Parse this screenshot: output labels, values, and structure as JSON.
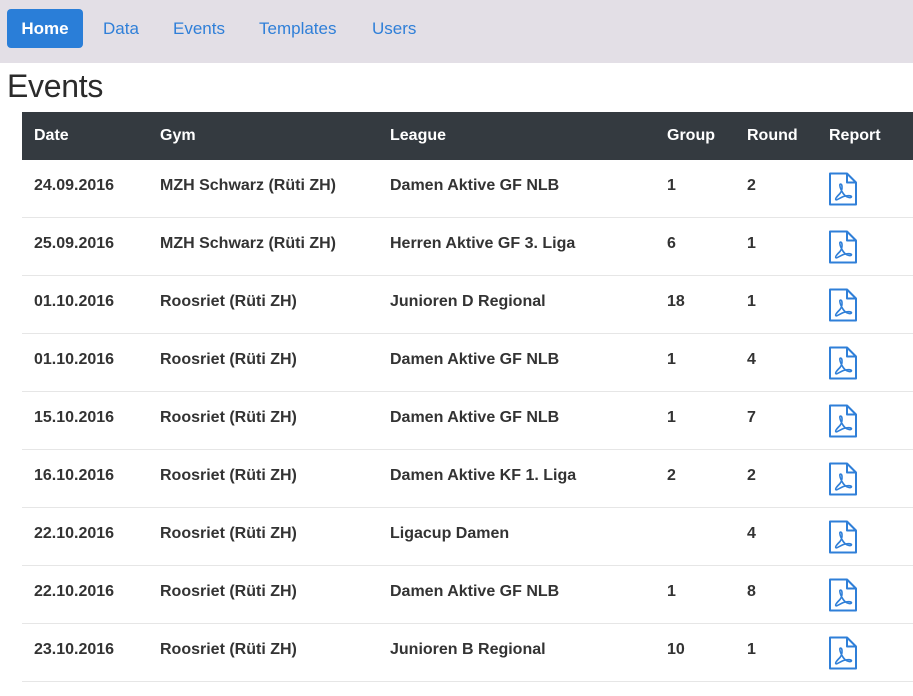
{
  "nav": {
    "items": [
      {
        "label": "Home",
        "active": true
      },
      {
        "label": "Data",
        "active": false
      },
      {
        "label": "Events",
        "active": false
      },
      {
        "label": "Templates",
        "active": false
      },
      {
        "label": "Users",
        "active": false
      }
    ]
  },
  "page": {
    "title": "Events"
  },
  "table": {
    "headers": [
      "Date",
      "Gym",
      "League",
      "Group",
      "Round",
      "Report"
    ],
    "report_icon": "pdf-file-icon",
    "rows": [
      {
        "date": "24.09.2016",
        "gym": "MZH Schwarz (Rüti ZH)",
        "league": "Damen Aktive GF NLB",
        "group": "1",
        "round": "2"
      },
      {
        "date": "25.09.2016",
        "gym": "MZH Schwarz (Rüti ZH)",
        "league": "Herren Aktive GF 3. Liga",
        "group": "6",
        "round": "1"
      },
      {
        "date": "01.10.2016",
        "gym": "Roosriet (Rüti ZH)",
        "league": "Junioren D Regional",
        "group": "18",
        "round": "1"
      },
      {
        "date": "01.10.2016",
        "gym": "Roosriet (Rüti ZH)",
        "league": "Damen Aktive GF NLB",
        "group": "1",
        "round": "4"
      },
      {
        "date": "15.10.2016",
        "gym": "Roosriet (Rüti ZH)",
        "league": "Damen Aktive GF NLB",
        "group": "1",
        "round": "7"
      },
      {
        "date": "16.10.2016",
        "gym": "Roosriet (Rüti ZH)",
        "league": "Damen Aktive KF 1. Liga",
        "group": "2",
        "round": "2"
      },
      {
        "date": "22.10.2016",
        "gym": "Roosriet (Rüti ZH)",
        "league": "Ligacup Damen",
        "group": "",
        "round": "4"
      },
      {
        "date": "22.10.2016",
        "gym": "Roosriet (Rüti ZH)",
        "league": "Damen Aktive GF NLB",
        "group": "1",
        "round": "8"
      },
      {
        "date": "23.10.2016",
        "gym": "Roosriet (Rüti ZH)",
        "league": "Junioren B Regional",
        "group": "10",
        "round": "1"
      }
    ]
  },
  "colors": {
    "accent": "#2a7ed8",
    "nav_bg": "#e3dfe6",
    "table_header_bg": "#343a40",
    "icon_blue": "#2f7fd8"
  }
}
